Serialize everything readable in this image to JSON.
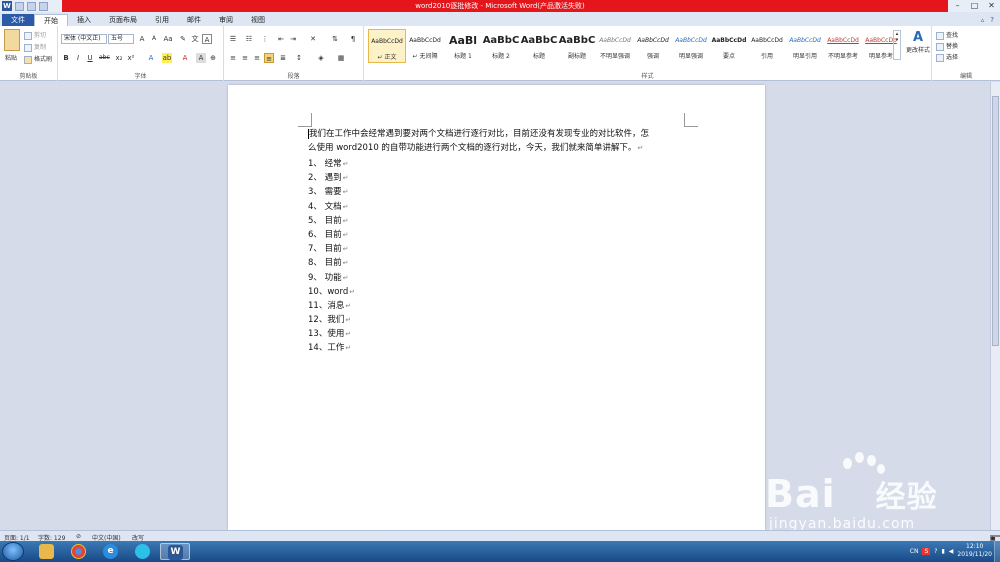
{
  "window": {
    "title": "word2010逐批修改 - Microsoft Word(产品激活失败)",
    "app_icon": "W",
    "controls": [
      "minimize-icon",
      "maximize-icon",
      "close-icon"
    ]
  },
  "tabs": [
    "文件",
    "开始",
    "插入",
    "页面布局",
    "引用",
    "邮件",
    "审阅",
    "视图"
  ],
  "active_tab": "开始",
  "ribbon": {
    "clipboard": {
      "paste": "粘贴",
      "cut": "剪切",
      "copy": "复制",
      "format_painter": "格式刷",
      "label": "剪贴板"
    },
    "font": {
      "font_name": "宋体 (中文正)",
      "font_size": "五号",
      "label": "字体",
      "buttons": [
        "B",
        "I",
        "U",
        "abc",
        "x₂",
        "x²",
        "A",
        "A",
        "Aa",
        "A"
      ]
    },
    "paragraph": {
      "label": "段落"
    },
    "styles": {
      "label": "样式",
      "items": [
        {
          "preview": "AaBbCcDd",
          "name": "↵ 正文",
          "selected": true
        },
        {
          "preview": "AaBbCcDd",
          "name": "↵ 无间隔"
        },
        {
          "preview": "AaBl",
          "name": "标题 1"
        },
        {
          "preview": "AaBbC",
          "name": "标题 2"
        },
        {
          "preview": "AaBbC",
          "name": "标题"
        },
        {
          "preview": "AaBbC",
          "name": "副标题"
        },
        {
          "preview": "AaBbCcDd",
          "name": "不明显强调"
        },
        {
          "preview": "AaBbCcDd",
          "name": "强调"
        },
        {
          "preview": "AaBbCcDd",
          "name": "明显强调"
        },
        {
          "preview": "AaBbCcDd",
          "name": "要点"
        },
        {
          "preview": "AaBbCcDd",
          "name": "引用"
        },
        {
          "preview": "AaBbCcDd",
          "name": "明显引用"
        },
        {
          "preview": "AaBbCcDd",
          "name": "不明显参考"
        },
        {
          "preview": "AaBbCcDo",
          "name": "明显参考"
        }
      ],
      "change_styles": "更改样式"
    },
    "editing": {
      "find": "查找",
      "replace": "替换",
      "select": "选择",
      "label": "编辑"
    }
  },
  "document": {
    "paragraph_line1": "我们在工作中会经常遇到要对两个文档进行逐行对比，目前还没有发现专业的对比软件，怎",
    "paragraph_line2": "么使用 word2010 的自带功能进行两个文档的逐行对比，今天，我们就来简单讲解下。",
    "list": [
      "1、 经常",
      "2、 遇到",
      "3、 需要",
      "4、 文档",
      "5、 目前",
      "6、 目前",
      "7、 目前",
      "8、 目前",
      "9、 功能",
      "10、word",
      "11、消息",
      "12、我们",
      "13、使用",
      "14、工作"
    ],
    "para_mark": "↵"
  },
  "status_bar": {
    "page": "页面: 1/1",
    "words": "字数: 129",
    "language": "中文(中国)",
    "mode": "改写"
  },
  "taskbar": {
    "apps": [
      "explorer",
      "chrome",
      "ie",
      "app",
      "word"
    ],
    "tray_lang": "CN",
    "time": "12:10",
    "date": "2019/11/20"
  },
  "watermark": {
    "brand": "Bai",
    "brand2": "经验",
    "url": "jingyan.baidu.com"
  }
}
